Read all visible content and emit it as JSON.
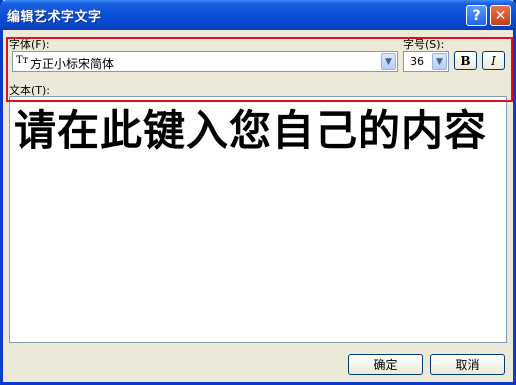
{
  "window": {
    "title": "编辑艺术字文字"
  },
  "titlebar": {
    "help_label": "?",
    "close_label": "✕"
  },
  "font": {
    "label": "字体(F):",
    "value": "方正小标宋简体",
    "icon_glyph": "Tт"
  },
  "size": {
    "label": "字号(S):",
    "value": "36"
  },
  "format": {
    "bold_label": "B",
    "italic_label": "I"
  },
  "text": {
    "label": "文本(T):",
    "content": "请在此键入您自己的内容"
  },
  "buttons": {
    "ok": "确定",
    "cancel": "取消"
  },
  "colors": {
    "titlebar": "#0a4fd8",
    "highlight": "#e0101a",
    "dialog_bg": "#ece9d8"
  }
}
